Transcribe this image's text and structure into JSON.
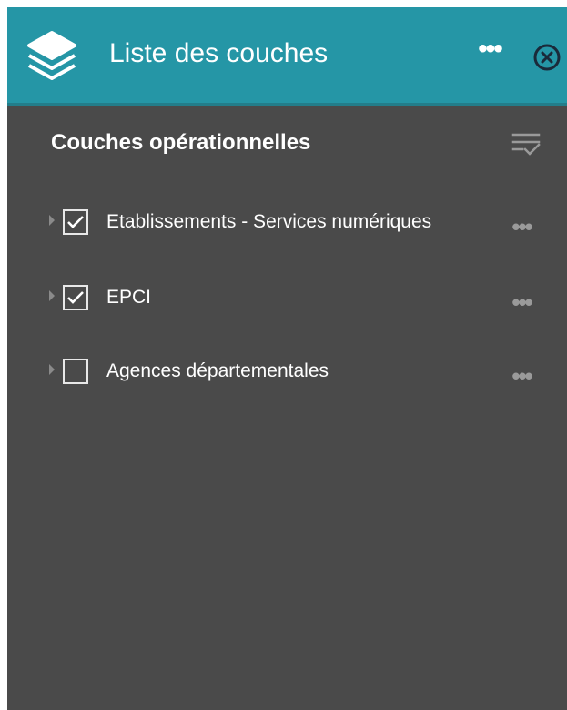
{
  "header": {
    "title": "Liste des couches",
    "more_label": "•••",
    "icons": {
      "app": "layers-icon",
      "close": "close-circle-icon"
    }
  },
  "section": {
    "title": "Couches opérationnelles",
    "icon": "filter-list-icon"
  },
  "layers": [
    {
      "label": "Etablissements - Services numériques",
      "checked": true,
      "more_label": "•••"
    },
    {
      "label": "EPCI",
      "checked": true,
      "more_label": "•••"
    },
    {
      "label": "Agences départementales",
      "checked": false,
      "more_label": "•••"
    }
  ],
  "colors": {
    "header_bg": "#2596a6",
    "panel_bg": "#4a4a4a",
    "text": "#ffffff",
    "muted": "#9a9a9a"
  }
}
